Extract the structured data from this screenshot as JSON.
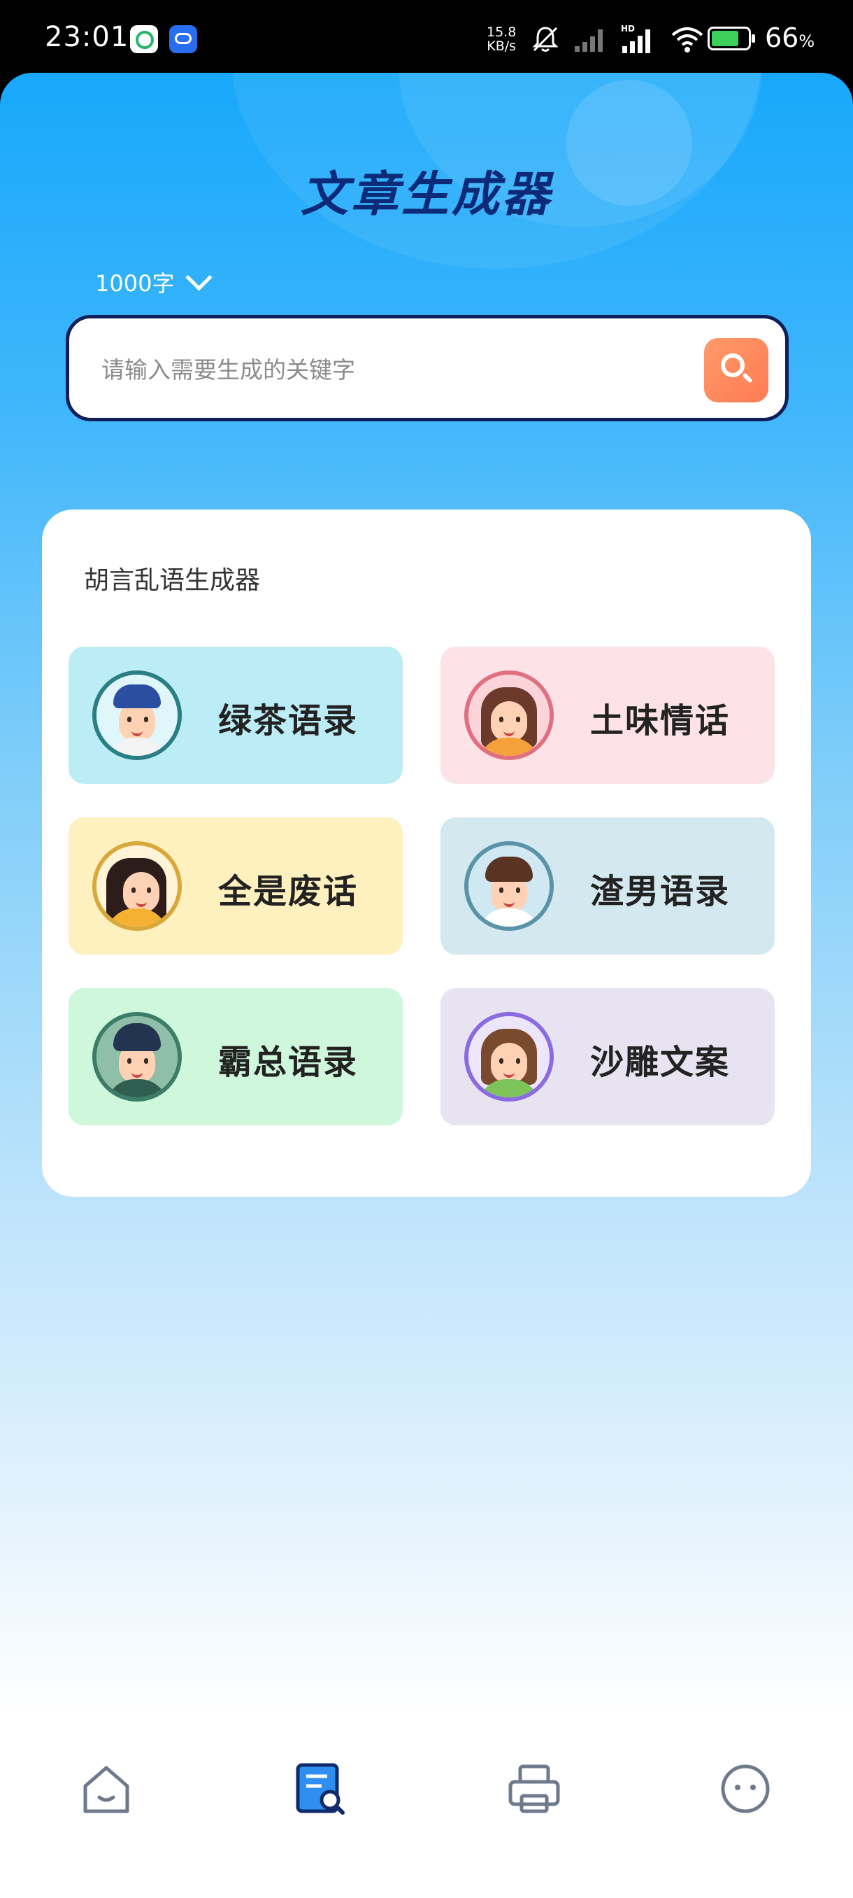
{
  "status_bar": {
    "time": "23:01",
    "speed_value": "15.8",
    "speed_unit": "KB/s",
    "battery_percent": "66",
    "battery_unit": "%",
    "icons": [
      "wechat-app-icon",
      "baidu-netdisk-app-icon",
      "mute-bell-icon",
      "signal-1-icon",
      "signal-hd-icon",
      "wifi-icon",
      "battery-charging-icon"
    ]
  },
  "header": {
    "title": "文章生成器",
    "word_count": "1000字"
  },
  "search": {
    "placeholder": "请输入需要生成的关键字",
    "value": ""
  },
  "generators": {
    "title": "胡言乱语生成器",
    "items": [
      {
        "label": "绿茶语录",
        "bg": "#bcecf5",
        "ring": "#2a7f85",
        "avatar": "boy-cap-avatar"
      },
      {
        "label": "土味情话",
        "bg": "#fde3e8",
        "ring": "#e0707f",
        "avatar": "girl-bangs-avatar"
      },
      {
        "label": "全是废话",
        "bg": "#fff0bf",
        "ring": "#d9a83a",
        "avatar": "girl-ponytail-avatar"
      },
      {
        "label": "渣男语录",
        "bg": "#d4e8ef",
        "ring": "#5a93a8",
        "avatar": "boy-glasses-avatar"
      },
      {
        "label": "霸总语录",
        "bg": "#cff7db",
        "ring": "#3b7d67",
        "avatar": "man-quiff-avatar"
      },
      {
        "label": "沙雕文案",
        "bg": "#e7e3f1",
        "ring": "#8a6be0",
        "avatar": "girl-bow-avatar"
      }
    ]
  },
  "tab_bar": {
    "tabs": [
      {
        "icon": "home-icon",
        "active": false
      },
      {
        "icon": "document-search-icon",
        "active": true
      },
      {
        "icon": "printer-icon",
        "active": false
      },
      {
        "icon": "chat-bubble-icon",
        "active": false
      }
    ]
  },
  "nav_bar": {
    "buttons": [
      "menu-icon",
      "home-square-icon",
      "back-icon"
    ]
  }
}
